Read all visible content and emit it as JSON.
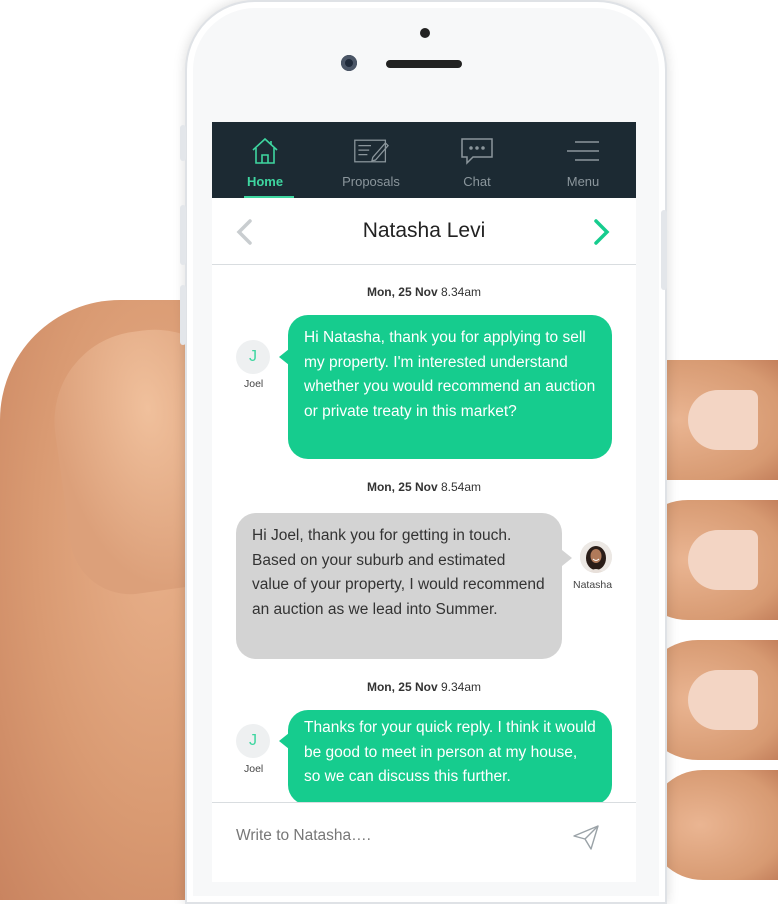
{
  "nav": {
    "items": [
      {
        "label": "Home",
        "icon": "home-icon",
        "active": true
      },
      {
        "label": "Proposals",
        "icon": "proposals-icon",
        "active": false
      },
      {
        "label": "Chat",
        "icon": "chat-icon",
        "active": false
      },
      {
        "label": "Menu",
        "icon": "menu-icon",
        "active": false
      }
    ]
  },
  "header": {
    "title": "Natasha Levi"
  },
  "messages": [
    {
      "ts_day": "Mon, 25 Nov",
      "ts_time": "8.34am",
      "direction": "out",
      "sender_initial": "J",
      "sender_name": "Joel",
      "text": "Hi Natasha, thank you for applying to sell my property. I'm interested understand whether you would recommend an auction or private treaty in this market?"
    },
    {
      "ts_day": "Mon, 25 Nov",
      "ts_time": "8.54am",
      "direction": "in",
      "sender_name": "Natasha",
      "text": "Hi Joel, thank you for getting in touch. Based on your suburb and estimated value of your property, I would recommend an auction as we lead into Summer."
    },
    {
      "ts_day": "Mon, 25 Nov",
      "ts_time": "9.34am",
      "direction": "out",
      "sender_initial": "J",
      "sender_name": "Joel",
      "text": "Thanks for your quick reply. I think it would be good to meet in person at my house, so we can discuss this further."
    }
  ],
  "composer": {
    "placeholder": "Write to Natasha…."
  },
  "colors": {
    "accent": "#3ed6a0",
    "outgoing_bubble": "#16cc8e",
    "incoming_bubble": "#d3d3d3",
    "nav_bg": "#1c2a33"
  }
}
